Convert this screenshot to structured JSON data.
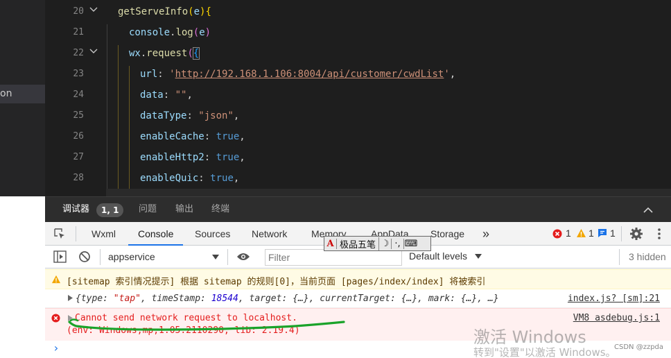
{
  "sidebar": {
    "selected_item_fragment": "on"
  },
  "editor": {
    "lines": [
      {
        "num": "20"
      },
      {
        "num": "21"
      },
      {
        "num": "22"
      },
      {
        "num": "23"
      },
      {
        "num": "24"
      },
      {
        "num": "25"
      },
      {
        "num": "26"
      },
      {
        "num": "27"
      },
      {
        "num": "28"
      }
    ],
    "code": {
      "l20_fn": "getServeInfo",
      "l20_open": "(",
      "l20_param": "e",
      "l20_close": ")",
      "l20_brace": "{",
      "l21_obj": "console",
      "l21_dot": ".",
      "l21_fn": "log",
      "l21_open": "(",
      "l21_param": "e",
      "l21_close": ")",
      "l22_obj": "wx",
      "l22_dot": ".",
      "l22_fn": "request",
      "l22_open": "(",
      "l22_brace": "{",
      "l23_key": "url",
      "l23_colon": ": ",
      "l23_q1": "'",
      "l23_url": "http://192.168.1.106:8004/api/customer/cwdList",
      "l23_q2": "'",
      "l23_comma": ",",
      "l24_key": "data",
      "l24_colon": ": ",
      "l24_val": "\"\"",
      "l24_comma": ",",
      "l25_key": "dataType",
      "l25_colon": ": ",
      "l25_val": "\"json\"",
      "l25_comma": ",",
      "l26_key": "enableCache",
      "l26_colon": ": ",
      "l26_val": "true",
      "l26_comma": ",",
      "l27_key": "enableHttp2",
      "l27_colon": ": ",
      "l27_val": "true",
      "l27_comma": ",",
      "l28_key": "enableQuic",
      "l28_colon": ": ",
      "l28_val": "true",
      "l28_comma": ","
    }
  },
  "panel_tabs": {
    "debugger": "调试器",
    "position": "1, 1",
    "problems": "问题",
    "output": "输出",
    "terminal": "终端"
  },
  "devtools": {
    "tabs": [
      "Wxml",
      "Console",
      "Sources",
      "Network",
      "Memory",
      "AppData",
      "Storage"
    ],
    "more_symbol": "»",
    "error_count": "1",
    "warning_count": "1",
    "info_count": "1",
    "context": "appservice",
    "filter_placeholder": "Filter",
    "levels": "Default levels",
    "hidden": "3 hidden"
  },
  "ime": {
    "mode": "A",
    "name": "极品五笔",
    "moon": "☽",
    "punct": "·,",
    "keyboard": "⌨"
  },
  "console": {
    "warning_text": "[sitemap 索引情况提示] 根据 sitemap 的规则[0]，当前页面 [pages/index/index] 将被索引",
    "log": {
      "open": "{",
      "k1": "type",
      "v1": "\"tap\"",
      "k2": "timeStamp",
      "v2": "18544",
      "k3": "target",
      "v3": "{…}",
      "k4": "currentTarget",
      "v4": "{…}",
      "k5": "mark",
      "v5": "{…}",
      "tail": "…}",
      "source": "index.js? [sm]:21"
    },
    "error": {
      "line1": "Cannot send network request to localhost.",
      "line2": "(env: Windows,mp,1.05.2110290; lib: 2.19.4)",
      "source": "VM8 asdebug.js:1"
    },
    "prompt": "›"
  },
  "watermark": {
    "line1": "激活 Windows",
    "line2": "转到\"设置\"以激活 Windows。",
    "credit": "CSDN @zzpda"
  },
  "colors": {
    "editor_bg": "#1e1e1e",
    "error_red": "#e41c1c",
    "warning_bg": "#fffbe5",
    "accent_blue": "#1a73e8",
    "annotation_green": "#1aa32a"
  }
}
